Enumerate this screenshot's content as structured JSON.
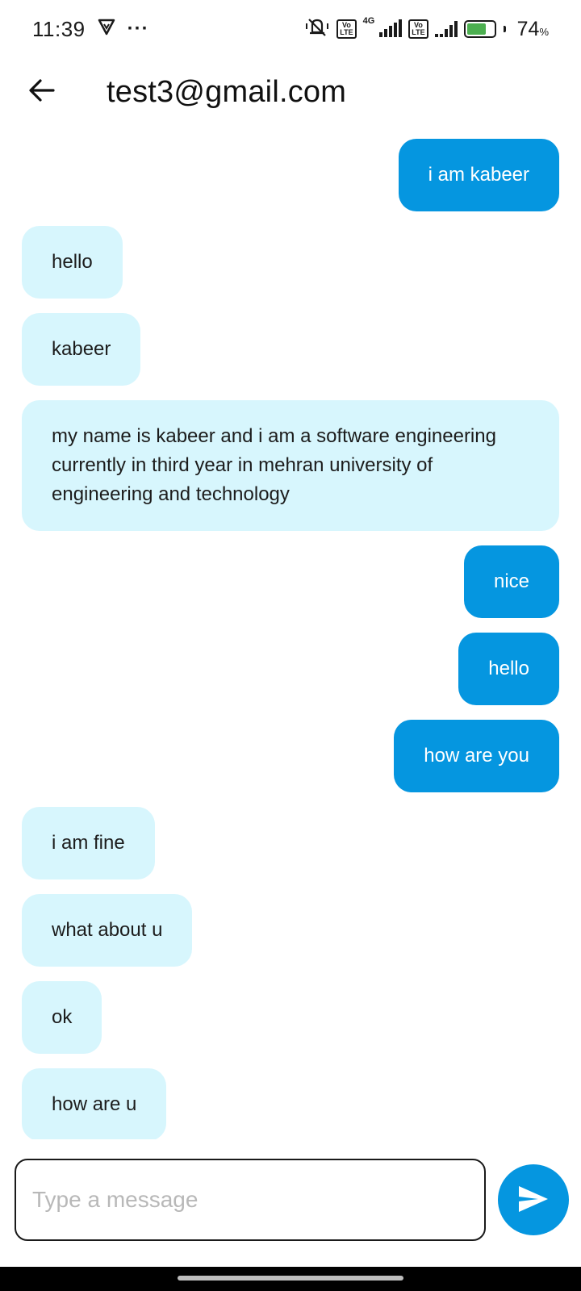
{
  "status_bar": {
    "time": "11:39",
    "dots": "···",
    "network": "4G",
    "volte": "Vo LTE",
    "battery_percent": "74",
    "battery_suffix": "%",
    "battery_level": 0.74,
    "battery_color": "#4caf50"
  },
  "app_bar": {
    "title": "test3@gmail.com",
    "back_icon": "arrow-back-icon"
  },
  "messages": [
    {
      "text": "i am kabeer",
      "type": "sent"
    },
    {
      "text": "hello",
      "type": "received"
    },
    {
      "text": "kabeer",
      "type": "received"
    },
    {
      "text": "my name is kabeer and i am a software engineering currently in third year in mehran university of engineering and technology",
      "type": "received"
    },
    {
      "text": "nice",
      "type": "sent"
    },
    {
      "text": "hello",
      "type": "sent"
    },
    {
      "text": "how are you",
      "type": "sent"
    },
    {
      "text": "i am fine",
      "type": "received"
    },
    {
      "text": "what about u",
      "type": "received"
    },
    {
      "text": "ok",
      "type": "received"
    },
    {
      "text": "how are u",
      "type": "received"
    }
  ],
  "composer": {
    "placeholder": "Type a message",
    "value": "",
    "send_icon": "send-icon"
  },
  "colors": {
    "sent_bubble": "#0596e0",
    "received_bubble": "#d7f6fd",
    "send_button": "#0596e0"
  }
}
